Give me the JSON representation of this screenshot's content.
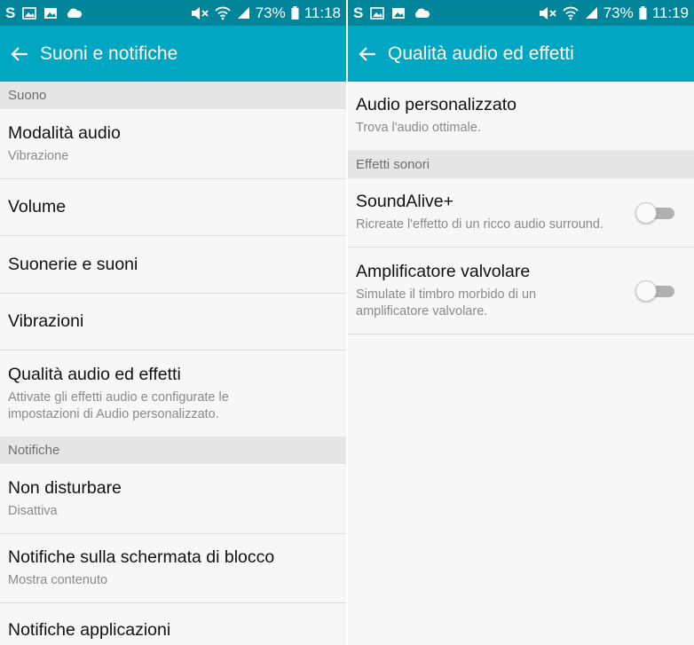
{
  "left": {
    "status": {
      "battery": "73%",
      "time": "11:18"
    },
    "title": "Suoni e notifiche",
    "sections": [
      {
        "header": "Suono"
      },
      {
        "header": "Notifiche"
      }
    ],
    "items": [
      {
        "title": "Modalità audio",
        "subtitle": "Vibrazione"
      },
      {
        "title": "Volume"
      },
      {
        "title": "Suonerie e suoni"
      },
      {
        "title": "Vibrazioni"
      },
      {
        "title": "Qualità audio ed effetti",
        "subtitle": "Attivate gli effetti audio e configurate le impostazioni di Audio personalizzato."
      },
      {
        "title": "Non disturbare",
        "subtitle": "Disattiva"
      },
      {
        "title": "Notifiche sulla schermata di blocco",
        "subtitle": "Mostra contenuto"
      },
      {
        "title": "Notifiche applicazioni"
      }
    ]
  },
  "right": {
    "status": {
      "battery": "73%",
      "time": "11:19"
    },
    "title": "Qualità audio ed effetti",
    "items": [
      {
        "title": "Audio personalizzato",
        "subtitle": "Trova l'audio ottimale."
      },
      {
        "title": "SoundAlive+",
        "subtitle": "Ricreate l'effetto di un ricco audio surround.",
        "enabled": false
      },
      {
        "title": "Amplificatore valvolare",
        "subtitle": "Simulate il timbro morbido di un amplificatore valvolare.",
        "enabled": false
      }
    ],
    "sections": [
      {
        "header": "Effetti sonori"
      }
    ]
  },
  "colors": {
    "statusbar": "#00859b",
    "appbar": "#00a7c3",
    "section_bg": "#e6e6e6",
    "background": "#f7f7f7"
  },
  "icons": [
    "s-app-icon",
    "gallery-icon",
    "image-icon",
    "cloud-icon",
    "mute-icon",
    "wifi-icon",
    "signal-icon",
    "battery-icon",
    "back-arrow-icon"
  ]
}
